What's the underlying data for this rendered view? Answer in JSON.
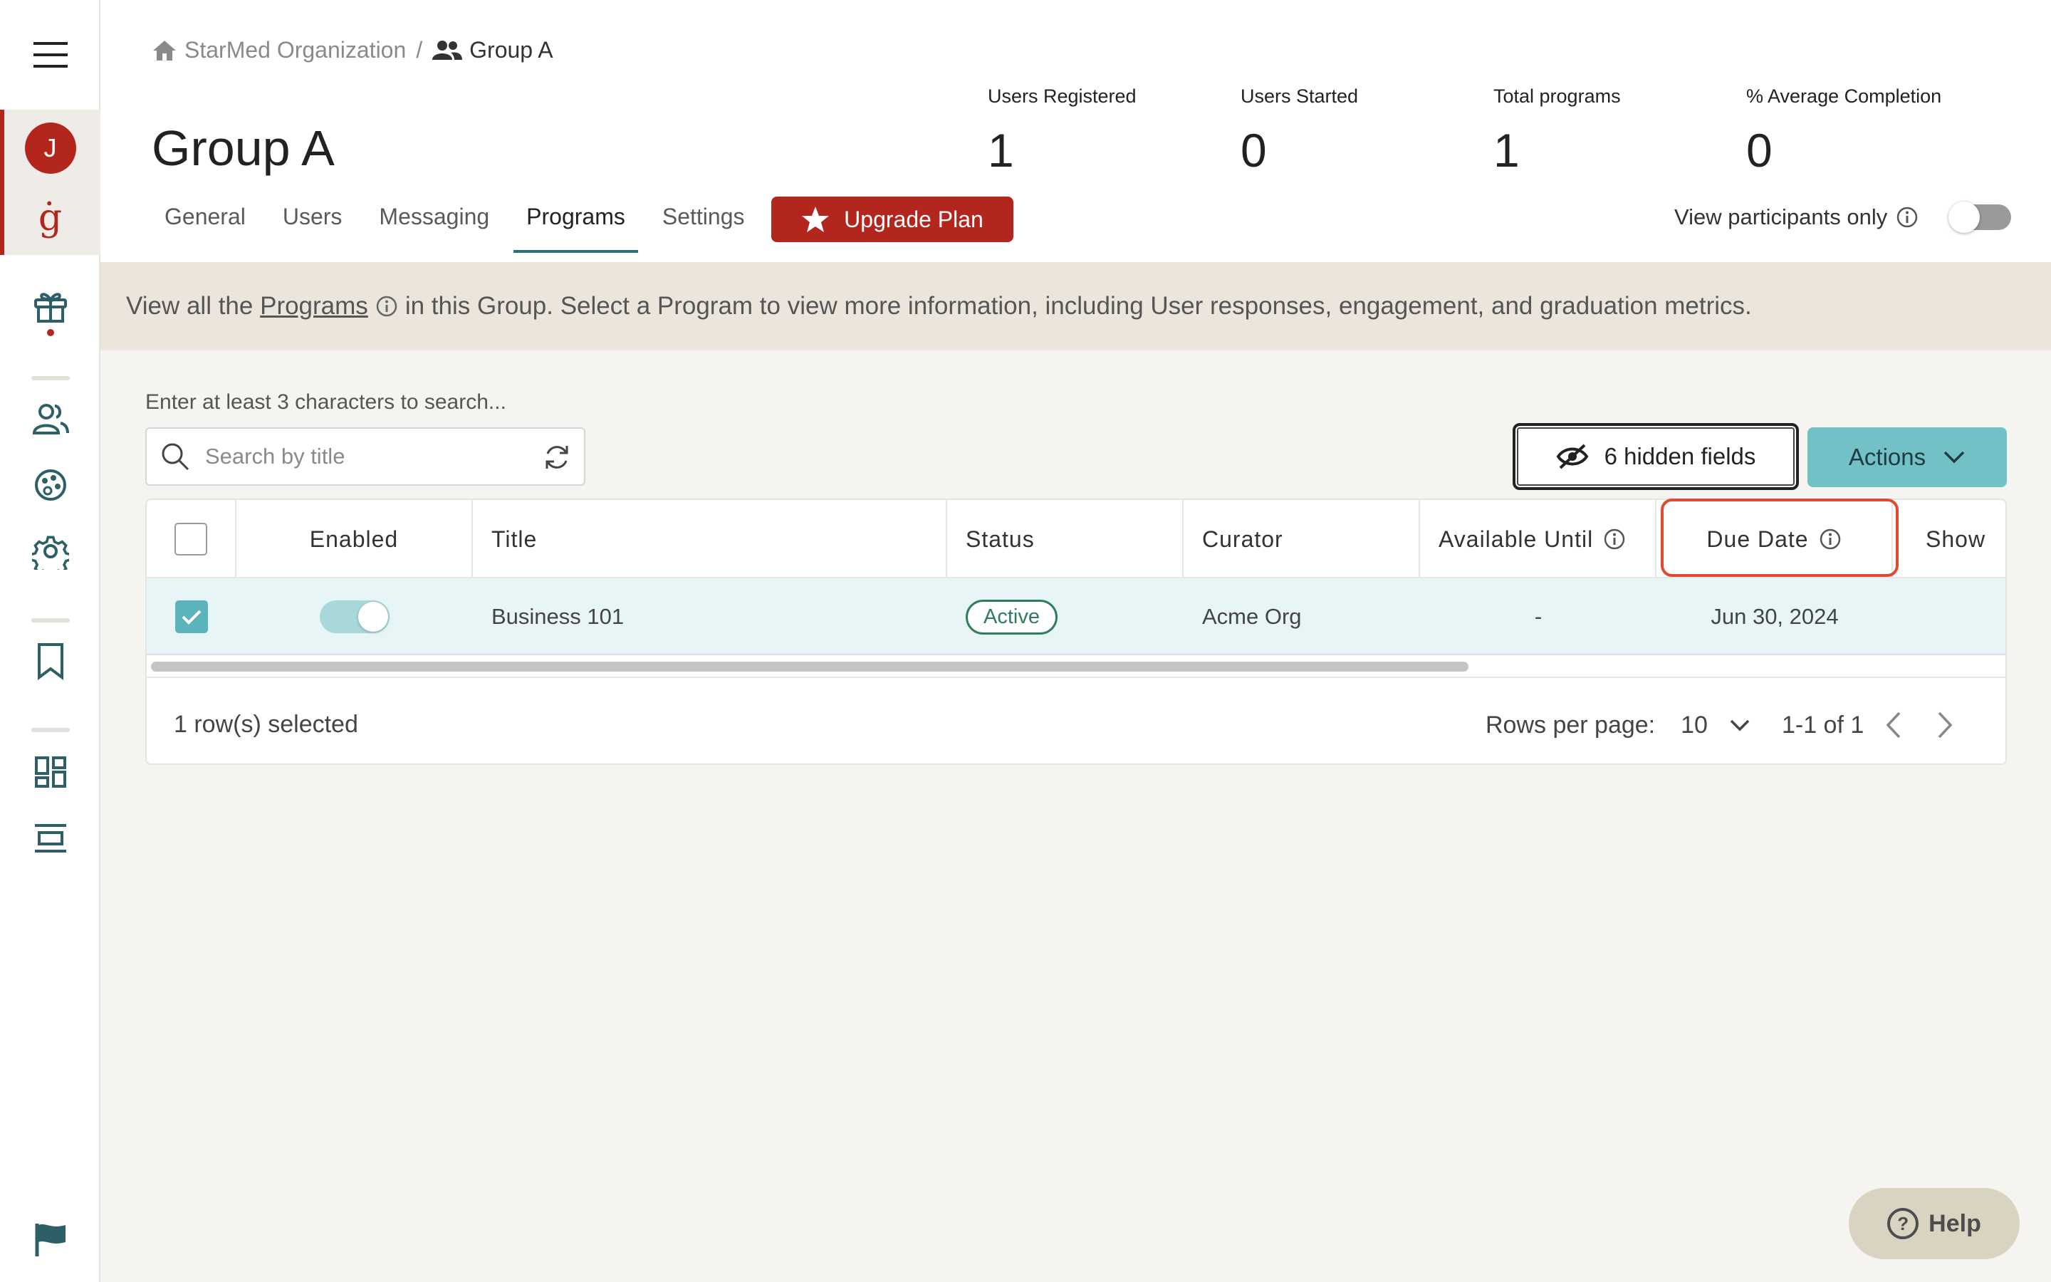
{
  "sidebar": {
    "avatar_initial": "J",
    "brand_glyph": "ġ",
    "icons": [
      "menu-icon",
      "gift-icon",
      "users-icon",
      "palette-icon",
      "gear-icon",
      "bookmark-icon",
      "dashboard-icon",
      "layout-icon",
      "flag-icon"
    ]
  },
  "breadcrumb": {
    "org": "StarMed Organization",
    "separator": "/",
    "group": "Group A"
  },
  "page_title": "Group A",
  "stats": [
    {
      "label": "Users Registered",
      "value": "1"
    },
    {
      "label": "Users Started",
      "value": "0"
    },
    {
      "label": "Total programs",
      "value": "1"
    },
    {
      "label": "% Average Completion",
      "value": "0"
    }
  ],
  "tabs": [
    {
      "label": "General",
      "active": false
    },
    {
      "label": "Users",
      "active": false
    },
    {
      "label": "Messaging",
      "active": false
    },
    {
      "label": "Programs",
      "active": true
    },
    {
      "label": "Settings",
      "active": false
    }
  ],
  "upgrade_label": "Upgrade Plan",
  "view_participants": {
    "label": "View participants only",
    "on": false
  },
  "banner": {
    "before": "View all the",
    "link": "Programs",
    "after": "in this Group. Select a Program to view more information, including User responses, engagement, and graduation metrics."
  },
  "search": {
    "label": "Enter at least 3 characters to search...",
    "placeholder": "Search by title",
    "value": ""
  },
  "hidden_fields_label": "6 hidden fields",
  "actions_label": "Actions",
  "table": {
    "columns": [
      "Enabled",
      "Title",
      "Status",
      "Curator",
      "Available Until",
      "Due Date",
      "Show"
    ],
    "rows": [
      {
        "selected": true,
        "enabled": true,
        "title": "Business 101",
        "status": "Active",
        "curator": "Acme Org",
        "available_until": "-",
        "due_date": "Jun 30, 2024"
      }
    ]
  },
  "footer": {
    "selected_text": "1 row(s) selected",
    "rows_per_page_label": "Rows per page:",
    "rows_per_page": "10",
    "range": "1-1 of 1"
  },
  "help_label": "Help",
  "colors": {
    "brand_red": "#b3261e",
    "teal": "#72c1c6",
    "highlight": "#e04a2f",
    "status_green": "#2e7d5b"
  }
}
